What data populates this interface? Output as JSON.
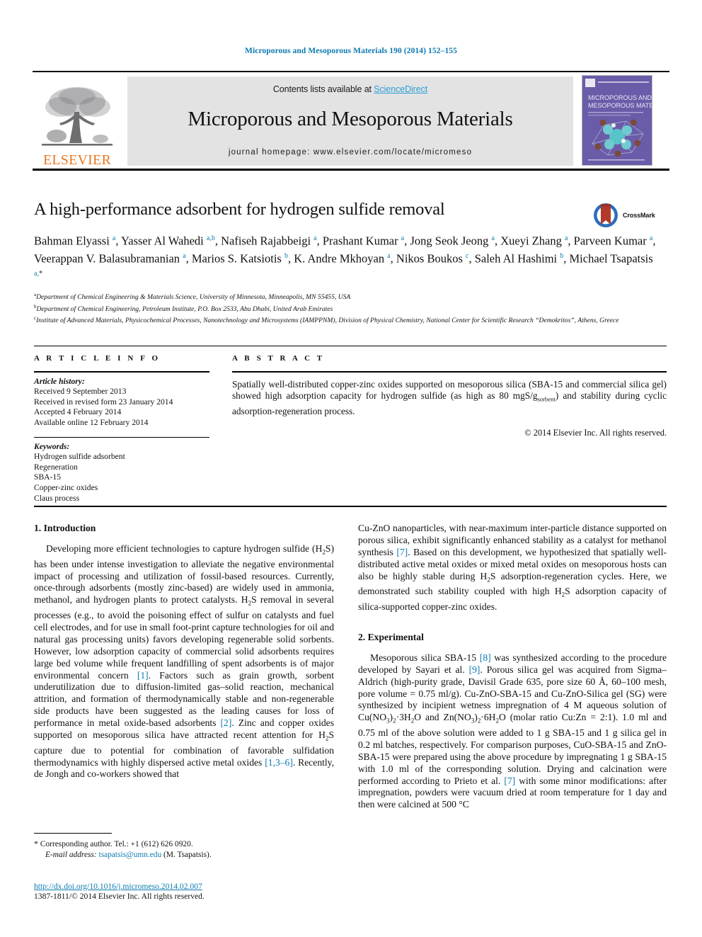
{
  "running_head": "Microporous and Mesoporous Materials 190 (2014) 152–155",
  "masthead": {
    "contents_prefix": "Contents lists available at ",
    "sciencedirect": "ScienceDirect",
    "journal_title": "Microporous and Mesoporous Materials",
    "homepage": "journal homepage: www.elsevier.com/locate/micromeso",
    "publisher": "ELSEVIER",
    "cover_title_line1": "MICROPOROUS AND",
    "cover_title_line2": "MESOPOROUS MATERIALS"
  },
  "article": {
    "title": "A high-performance adsorbent for hydrogen sulfide removal",
    "crossmark_label": "CrossMark",
    "authors_html": "Bahman Elyassi <sup>a</sup>, Yasser Al Wahedi <sup>a,b</sup>, Nafiseh Rajabbeigi <sup>a</sup>, Prashant Kumar <sup>a</sup>, Jong Seok Jeong <sup>a</sup>, Xueyi Zhang <sup>a</sup>, Parveen Kumar <sup>a</sup>, Veerappan V. Balasubramanian <sup>a</sup>, Marios S. Katsiotis <sup>b</sup>, K. Andre Mkhoyan <sup>a</sup>, Nikos Boukos <sup>c</sup>, Saleh Al Hashimi <sup>b</sup>, Michael Tsapatsis <sup>a,</sup><sup class=\"star\">*</sup>",
    "affiliations": [
      {
        "mark": "a",
        "text": "Department of Chemical Engineering & Materials Science, University of Minnesota, Minneapolis, MN 55455, USA"
      },
      {
        "mark": "b",
        "text": "Department of Chemical Engineering, Petroleum Institute, P.O. Box 2533, Abu Dhabi, United Arab Emirates"
      },
      {
        "mark": "c",
        "text": "Institute of Advanced Materials, Physicochemical Processes, Nanotechnology and Microsystems (IAMPPNM), Division of Physical Chemistry, National Center for Scientific Research “Demokritos”, Athens, Greece"
      }
    ]
  },
  "article_info": {
    "heading": "A R T I C L E  I N F O",
    "history_label": "Article history:",
    "history": [
      "Received 9 September 2013",
      "Received in revised form 23 January 2014",
      "Accepted 4 February 2014",
      "Available online 12 February 2014"
    ],
    "keywords_label": "Keywords:",
    "keywords": [
      "Hydrogen sulfide adsorbent",
      "Regeneration",
      "SBA-15",
      "Copper-zinc oxides",
      "Claus process"
    ]
  },
  "abstract": {
    "heading": "A B S T R A C T",
    "text_html": "Spatially well-distributed copper-zinc oxides supported on mesoporous silica (SBA-15 and commercial silica gel) showed high adsorption capacity for hydrogen sulfide (as high as 80 mgS/g<sub>sorbent</sub>) and stability during cyclic adsorption-regeneration process.",
    "copyright": "© 2014 Elsevier Inc. All rights reserved."
  },
  "body": {
    "section1_heading": "1. Introduction",
    "section1_paragraph_html": "Developing more efficient technologies to capture hydrogen sulfide (H<sub>2</sub>S) has been under intense investigation to alleviate the negative environmental impact of processing and utilization of fossil-based resources. Currently, once-through adsorbents (mostly zinc-based) are widely used in ammonia, methanol, and hydrogen plants to protect catalysts. H<sub>2</sub>S removal in several processes (e.g., to avoid the poisoning effect of sulfur on catalysts and fuel cell electrodes, and for use in small foot-print capture technologies for oil and natural gas processing units) favors developing regenerable solid sorbents. However, low adsorption capacity of commercial solid adsorbents requires large bed volume while frequent landfilling of spent adsorbents is of major environmental concern <span class=\"ref\">[1]</span>. Factors such as grain growth, sorbent underutilization due to diffusion-limited gas–solid reaction, mechanical attrition, and formation of thermodynamically stable and non-regenerable side products have been suggested as the leading causes for loss of performance in metal oxide-based adsorbents <span class=\"ref\">[2]</span>. Zinc and copper oxides supported on mesoporous silica have attracted recent attention for H<sub>2</sub>S capture due to potential for combination of favorable sulfidation thermodynamics with highly dispersed active metal oxides <span class=\"ref\">[1,3–6]</span>. Recently, de Jongh and co-workers showed that",
    "section1_continuation_html": "Cu-ZnO nanoparticles, with near-maximum inter-particle distance supported on porous silica, exhibit significantly enhanced stability as a catalyst for methanol synthesis <span class=\"ref\">[7]</span>. Based on this development, we hypothesized that spatially well-distributed active metal oxides or mixed metal oxides on mesoporous hosts can also be highly stable during H<sub>2</sub>S adsorption-regeneration cycles. Here, we demonstrated such stability coupled with high H<sub>2</sub>S adsorption capacity of silica-supported copper-zinc oxides.",
    "section2_heading": "2. Experimental",
    "section2_paragraph_html": "Mesoporous silica SBA-15 <span class=\"ref\">[8]</span> was synthesized according to the procedure developed by Sayari et al. <span class=\"ref\">[9]</span>. Porous silica gel was acquired from Sigma–Aldrich (high-purity grade, Davisil Grade 635, pore size 60 Å, 60–100 mesh, pore volume = 0.75 ml/g). Cu-ZnO-SBA-15 and Cu-ZnO-Silica gel (SG) were synthesized by incipient wetness impregnation of 4 M aqueous solution of Cu(NO<sub>3</sub>)<sub>2</sub>·3H<sub>2</sub>O and Zn(NO<sub>3</sub>)<sub>2</sub>·6H<sub>2</sub>O (molar ratio Cu:Zn = 2:1). 1.0 ml and 0.75 ml of the above solution were added to 1 g SBA-15 and 1 g silica gel in 0.2 ml batches, respectively. For comparison purposes, CuO-SBA-15 and ZnO-SBA-15 were prepared using the above procedure by impregnating 1 g SBA-15 with 1.0 ml of the corresponding solution. Drying and calcination were performed according to Prieto et al. <span class=\"ref\">[7]</span> with some minor modifications: after impregnation, powders were vacuum dried at room temperature for 1 day and then were calcined at 500 °C"
  },
  "footer": {
    "corresponding_star": "*",
    "corresponding_text": "Corresponding author. Tel.: +1 (612) 626 0920.",
    "email_label": "E-mail address:",
    "email": "tsapatsis@umn.edu",
    "email_suffix": "(M. Tsapatsis).",
    "doi_url": "http://dx.doi.org/10.1016/j.micromeso.2014.02.007",
    "issn_line": "1387-1811/© 2014 Elsevier Inc. All rights reserved."
  },
  "colors": {
    "link_blue": "#0b7ab0",
    "sciencedirect_blue": "#2a9fd6",
    "elsevier_orange": "#E87722",
    "band_gray": "#e3e3e3",
    "cover_purple": "#6a5ca8"
  }
}
